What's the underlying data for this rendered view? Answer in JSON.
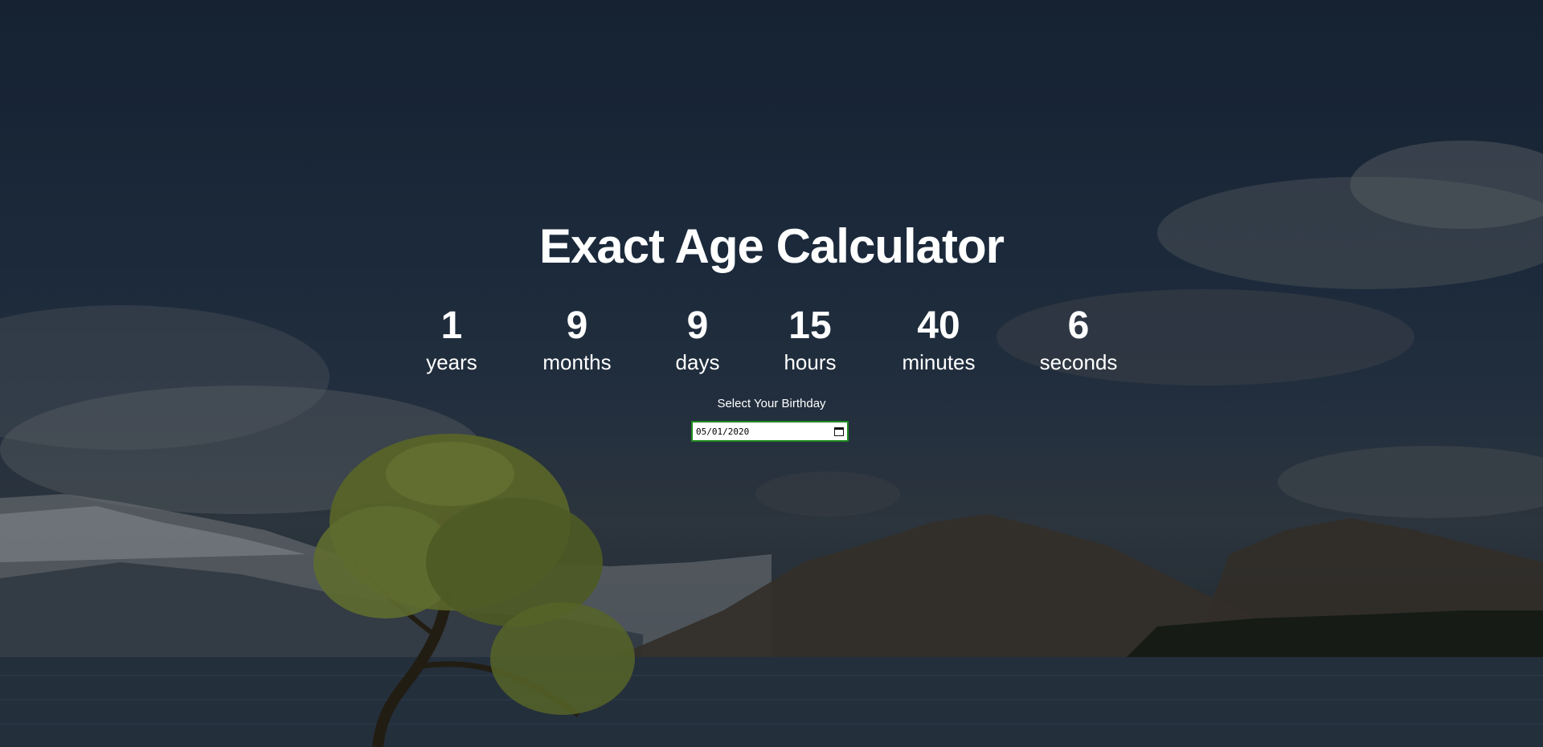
{
  "title": "Exact Age Calculator",
  "units": [
    {
      "value": "1",
      "label": "years"
    },
    {
      "value": "9",
      "label": "months"
    },
    {
      "value": "9",
      "label": "days"
    },
    {
      "value": "15",
      "label": "hours"
    },
    {
      "value": "40",
      "label": "minutes"
    },
    {
      "value": "6",
      "label": "seconds"
    }
  ],
  "picker": {
    "label": "Select Your Birthday",
    "value": "05/01/2020",
    "icon": "calendar-icon"
  },
  "colors": {
    "text": "#ffffff",
    "input_border": "#1f8a1f"
  }
}
